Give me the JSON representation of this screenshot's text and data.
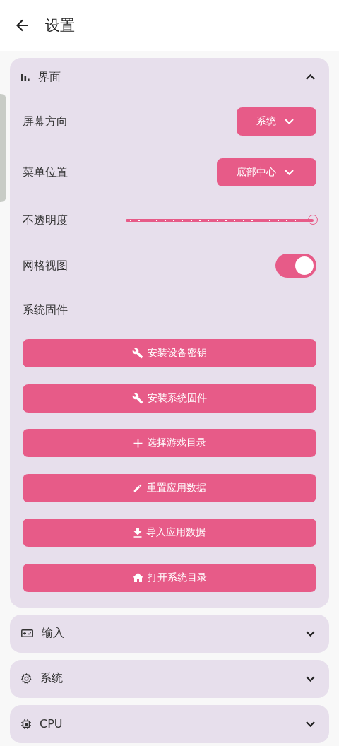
{
  "app_bar": {
    "title": "设置"
  },
  "sections": [
    {
      "title": "界面",
      "expanded": true,
      "settings": [
        {
          "kind": "dropdown",
          "label": "屏幕方向",
          "value": "系统"
        },
        {
          "kind": "dropdown",
          "label": "菜单位置",
          "value": "底部中心"
        },
        {
          "kind": "slider",
          "label": "不透明度",
          "level": 1
        },
        {
          "kind": "switch",
          "label": "网格视图",
          "on": true
        },
        {
          "kind": "heading",
          "label": "系统固件"
        }
      ],
      "buttons": [
        "安装设备密钥",
        "安装系统固件",
        "选择游戏目录",
        "重置应用数据",
        "导入应用数据",
        "打开系统目录"
      ]
    },
    {
      "title": "输入",
      "expanded": false
    },
    {
      "title": "系统",
      "expanded": false
    },
    {
      "title": "CPU",
      "expanded": false
    }
  ]
}
